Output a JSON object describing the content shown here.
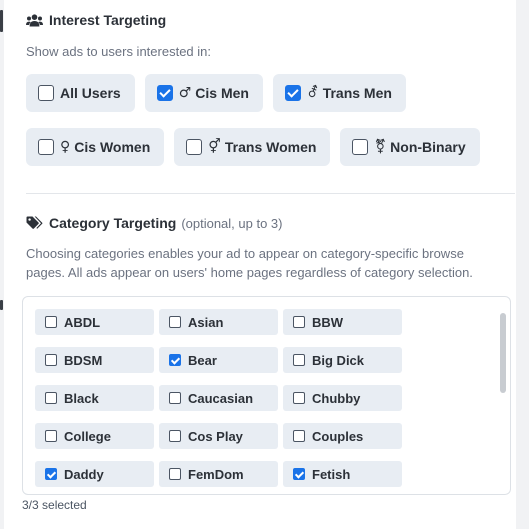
{
  "interest": {
    "title": "Interest Targeting",
    "icon": "users-icon",
    "hint": "Show ads to users interested in:",
    "rows": [
      [
        {
          "name": "all-users",
          "label": "All Users",
          "symbol": "",
          "checked": false
        },
        {
          "name": "cis-men",
          "label": "Cis Men",
          "symbol": "♂",
          "checked": true
        },
        {
          "name": "trans-men",
          "label": "Trans Men",
          "symbol": "⚦",
          "checked": true
        }
      ],
      [
        {
          "name": "cis-women",
          "label": "Cis Women",
          "symbol": "♀",
          "checked": false
        },
        {
          "name": "trans-women",
          "label": "Trans Women",
          "symbol": "⚥",
          "checked": false
        },
        {
          "name": "non-binary",
          "label": "Non-Binary",
          "symbol": "⚧",
          "checked": false
        }
      ]
    ]
  },
  "category": {
    "title": "Category Targeting",
    "optional_note": "(optional, up to 3)",
    "icon": "tags-icon",
    "hint": "Choosing categories enables your ad to appear on category-specific browse pages. All ads appear on users' home pages regardless of category selection.",
    "items": [
      {
        "label": "ABDL",
        "checked": false
      },
      {
        "label": "Asian",
        "checked": false
      },
      {
        "label": "BBW",
        "checked": false
      },
      {
        "label": "BDSM",
        "checked": false
      },
      {
        "label": "Bear",
        "checked": true
      },
      {
        "label": "Big Dick",
        "checked": false
      },
      {
        "label": "Black",
        "checked": false
      },
      {
        "label": "Caucasian",
        "checked": false
      },
      {
        "label": "Chubby",
        "checked": false
      },
      {
        "label": "College",
        "checked": false
      },
      {
        "label": "Cos Play",
        "checked": false
      },
      {
        "label": "Couples",
        "checked": false
      },
      {
        "label": "Daddy",
        "checked": true
      },
      {
        "label": "FemDom",
        "checked": false
      },
      {
        "label": "Fetish",
        "checked": true
      }
    ],
    "selected_count": "3/3 selected"
  },
  "colors": {
    "accent": "#1a73e8",
    "chip_bg": "#e8edf3",
    "text": "#2c3138",
    "muted": "#6b7280"
  }
}
